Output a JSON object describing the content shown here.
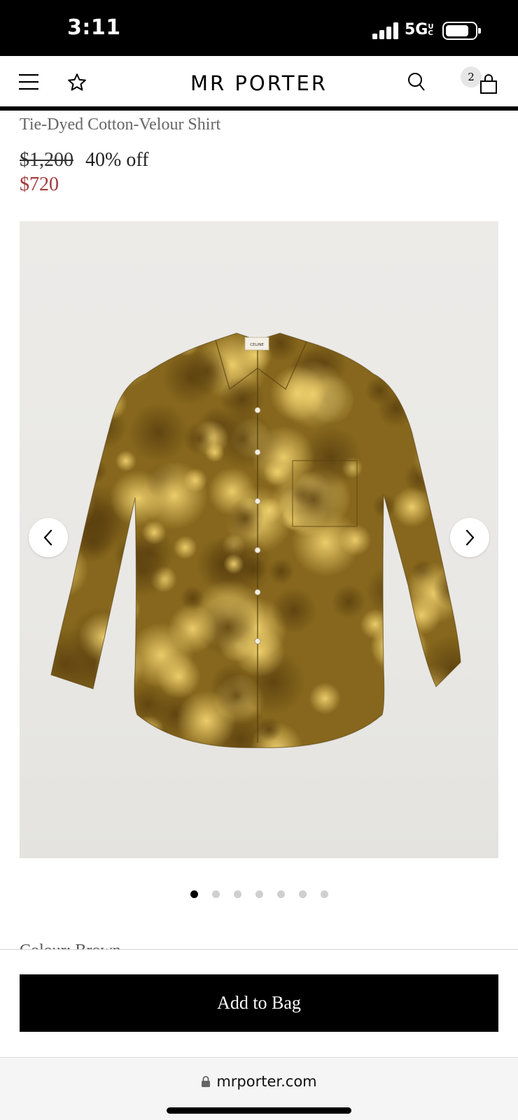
{
  "status_bar": {
    "time": "3:11",
    "network": "5GUC",
    "network_display": "5G",
    "battery_level": 0.8
  },
  "nav": {
    "menu_icon": "hamburger-menu-icon",
    "wishlist_icon": "star-outline-icon",
    "brand": "MR PORTER",
    "search_icon": "search-icon",
    "bag_icon": "shopping-bag-icon",
    "bag_count": "2"
  },
  "product": {
    "title": "Tie-Dyed Cotton-Velour Shirt",
    "original_price": "$1,200",
    "discount": "40% off",
    "sale_price": "$720",
    "image_alt": "tie-dyed shirt product photo",
    "garment_label": "CELINE"
  },
  "gallery": {
    "prev_icon": "chevron-left-icon",
    "next_icon": "chevron-right-icon",
    "page_count": 7,
    "active_index": 0
  },
  "below_fold_text": "Colour: Brown",
  "cta": {
    "add_to_bag": "Add to Bag"
  },
  "browser": {
    "lock_icon": "lock-icon",
    "url": "mrporter.com"
  },
  "colors": {
    "sale_price": "#a33b3b",
    "cta_background": "#000000",
    "shirt_base": "#8a6a1c",
    "shirt_light": "#e2c25a"
  }
}
